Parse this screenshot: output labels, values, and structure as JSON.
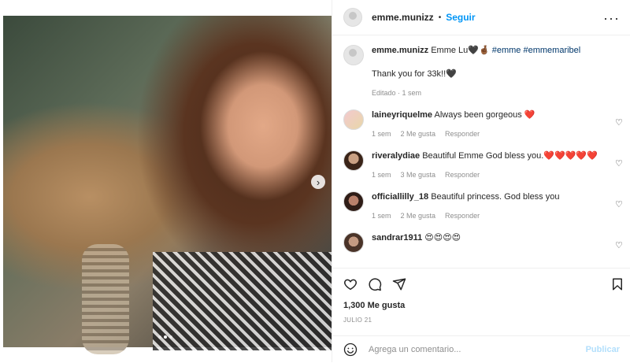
{
  "header": {
    "username": "emme.munizz",
    "separator": "•",
    "follow_label": "Seguir",
    "more_icon": "more-horizontal-icon"
  },
  "caption": {
    "username": "emme.munizz",
    "text_before": "Emme Lu",
    "emoji": "🖤🤞🏾",
    "hashtags": "#emme #emmemaribel",
    "line2": "Thank you for 33k!!🖤",
    "meta": "Editado · 1 sem"
  },
  "comments": [
    {
      "username": "laineyriquelme",
      "text": "Always been gorgeous",
      "emoji": "❤️",
      "age": "1 sem",
      "likes": "2 Me gusta",
      "reply": "Responder"
    },
    {
      "username": "riveralydiae",
      "text": "Beautiful Emme God bless you.",
      "emoji": "❤️❤️❤️❤️❤️",
      "age": "1 sem",
      "likes": "3 Me gusta",
      "reply": "Responder"
    },
    {
      "username": "officiallilly_18",
      "text": "Beautiful princess. God bless you",
      "emoji": "",
      "age": "1 sem",
      "likes": "2 Me gusta",
      "reply": "Responder"
    },
    {
      "username": "sandrar1911",
      "text": "",
      "emoji": "😍😍😍😍",
      "age": "",
      "likes": "",
      "reply": ""
    }
  ],
  "footer": {
    "likes": "1,300 Me gusta",
    "date": "JULIO 21",
    "comment_placeholder": "Agrega un comentario...",
    "publish_label": "Publicar"
  },
  "carousel": {
    "slide_count": 3,
    "active_index": 1
  }
}
